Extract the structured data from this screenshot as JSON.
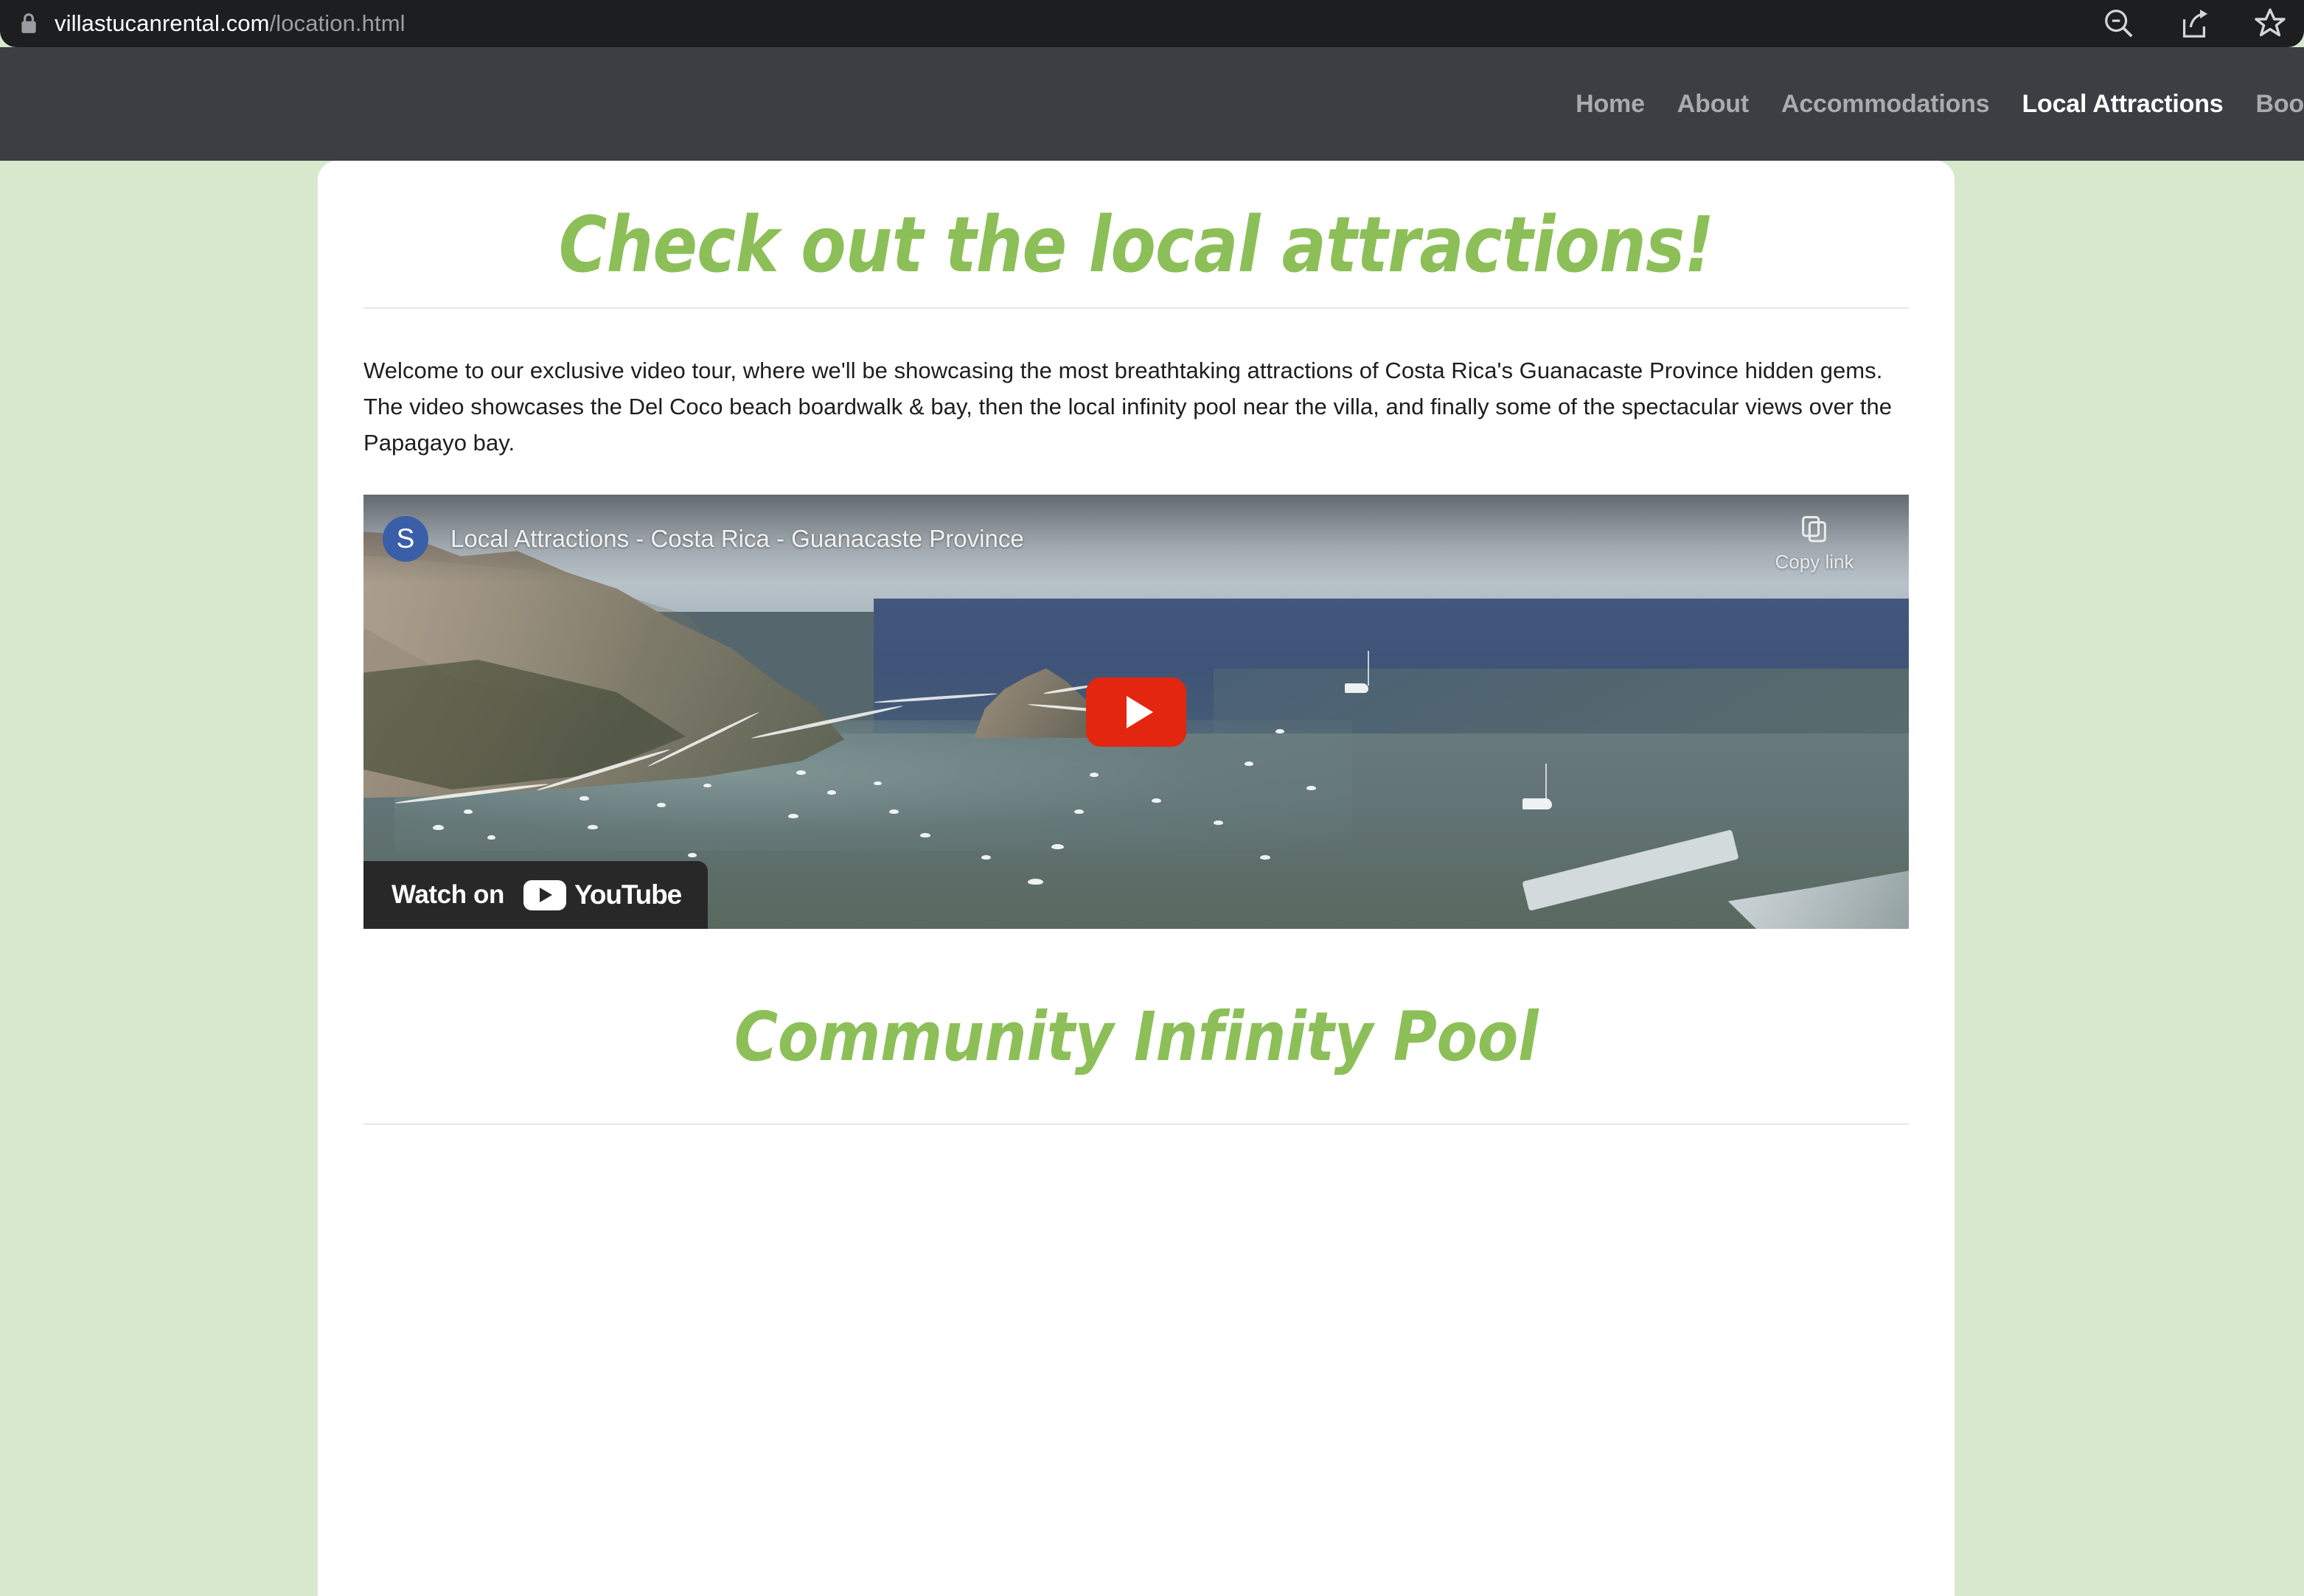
{
  "browser": {
    "url_domain": "villastucanrental.com",
    "url_path": "/location.html",
    "lock_icon": "lock-icon",
    "actions": [
      {
        "name": "zoom-out-icon",
        "label": "Zoom out"
      },
      {
        "name": "share-icon",
        "label": "Share"
      },
      {
        "name": "favorite-star-icon",
        "label": "Add to favorites"
      }
    ]
  },
  "site_nav": {
    "items": [
      {
        "label": "Home",
        "active": false
      },
      {
        "label": "About",
        "active": false
      },
      {
        "label": "Accommodations",
        "active": false
      },
      {
        "label": "Local Attractions",
        "active": true
      },
      {
        "label": "Boo",
        "active": false,
        "clipped": true
      }
    ]
  },
  "page": {
    "title": "Check out the local attractions!",
    "intro": "Welcome to our exclusive video tour, where we'll be showcasing the most breathtaking attractions of Costa Rica's Guanacaste Province hidden gems. The video showcases the Del Coco beach boardwalk & bay, then the local infinity pool near the villa, and finally some of the spectacular views over the Papagayo bay.",
    "section_title": "Community Infinity Pool"
  },
  "video": {
    "avatar_initial": "S",
    "title": "Local Attractions - Costa Rica - Guanacaste Province",
    "copy_link_label": "Copy link",
    "copy_link_icon": "copy-icon",
    "play_button": "play-button",
    "watch_on_label": "Watch on",
    "youtube_word": "YouTube",
    "youtube_icon": "youtube-play-icon",
    "scene_description": "Aerial view of a rocky coastal headland and bay with many moored boats"
  },
  "colors": {
    "brand_green": "#8dbf58",
    "page_background": "#d7e8cd",
    "nav_background": "#3b3e43",
    "urlbar_background": "#1d1e20",
    "youtube_red": "#e3260f",
    "avatar_blue": "#3a5fa8",
    "card_white": "#ffffff",
    "divider_gray": "#e6e6e6"
  }
}
